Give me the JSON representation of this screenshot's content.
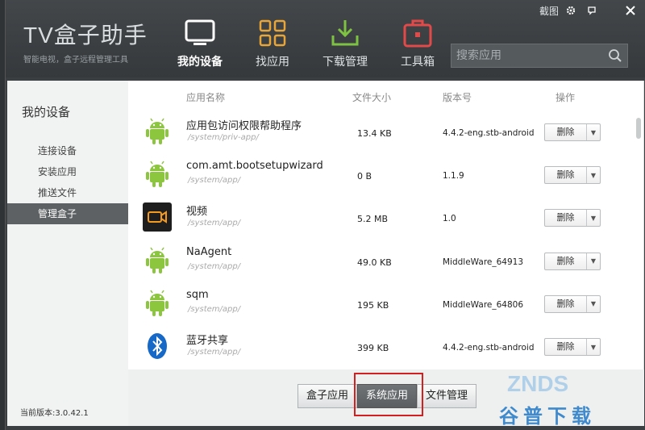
{
  "logo": {
    "title": "TV盒子助手",
    "subtitle": "智能电视，盒子远程管理工具"
  },
  "window": {
    "screenshot_label": "截图"
  },
  "nav": [
    {
      "label": "我的设备",
      "icon": "tv-icon"
    },
    {
      "label": "找应用",
      "icon": "grid-icon"
    },
    {
      "label": "下载管理",
      "icon": "download-icon"
    },
    {
      "label": "工具箱",
      "icon": "toolbox-icon"
    }
  ],
  "search": {
    "placeholder": "搜索应用"
  },
  "sidebar": {
    "title": "我的设备",
    "items": [
      "连接设备",
      "安装应用",
      "推送文件",
      "管理盒子"
    ],
    "active": "管理盒子",
    "version": "当前版本:3.0.42.1"
  },
  "table": {
    "headers": {
      "name": "应用名称",
      "size": "文件大小",
      "version": "版本号",
      "action": "操作"
    },
    "rows": [
      {
        "icon": "android-icon",
        "name": "应用包访问权限帮助程序",
        "path": "/system/priv-app/",
        "size": "13.4 KB",
        "version": "4.4.2-eng.stb-android",
        "action": "删除"
      },
      {
        "icon": "android-icon",
        "name": "com.amt.bootsetupwizard",
        "path": "/system/app/",
        "size": "0 B",
        "version": "1.1.9",
        "action": "删除"
      },
      {
        "icon": "video-icon",
        "name": "视频",
        "path": "/system/app/",
        "size": "5.2 MB",
        "version": "1.0",
        "action": "删除"
      },
      {
        "icon": "android-icon",
        "name": "NaAgent",
        "path": "/system/app/",
        "size": "49.0 KB",
        "version": "MiddleWare_64913",
        "action": "删除"
      },
      {
        "icon": "android-icon",
        "name": "sqm",
        "path": "/system/app/",
        "size": "195 KB",
        "version": "MiddleWare_64806",
        "action": "删除"
      },
      {
        "icon": "bluetooth-icon",
        "name": "蓝牙共享",
        "path": "/system/app/",
        "size": "399 KB",
        "version": "4.4.2-eng.stb-android",
        "action": "删除"
      }
    ]
  },
  "tabs": [
    "盒子应用",
    "系统应用",
    "文件管理"
  ],
  "active_tab": "系统应用",
  "watermark": {
    "top": "ZNDS",
    "bottom": "谷普下载"
  }
}
